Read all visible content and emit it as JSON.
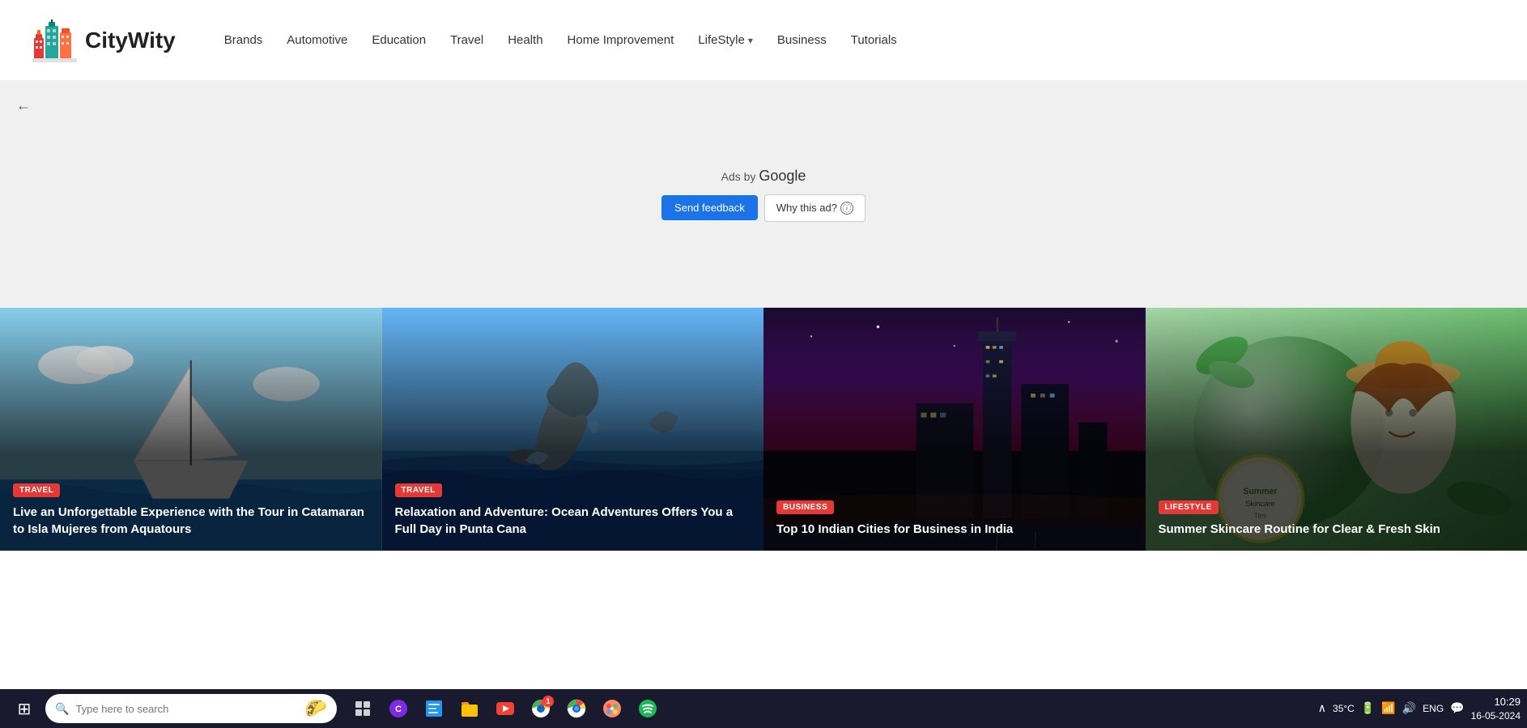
{
  "header": {
    "logo_text": "CityWity",
    "nav_items": [
      {
        "label": "Brands",
        "has_dropdown": false
      },
      {
        "label": "Automotive",
        "has_dropdown": false
      },
      {
        "label": "Education",
        "has_dropdown": false
      },
      {
        "label": "Travel",
        "has_dropdown": false
      },
      {
        "label": "Health",
        "has_dropdown": false
      },
      {
        "label": "Home Improvement",
        "has_dropdown": false
      },
      {
        "label": "LifeStyle",
        "has_dropdown": true
      },
      {
        "label": "Business",
        "has_dropdown": false
      },
      {
        "label": "Tutorials",
        "has_dropdown": false
      }
    ]
  },
  "ad_area": {
    "ads_label": "Ads by ",
    "google_label": "Google",
    "send_feedback_label": "Send feedback",
    "why_this_ad_label": "Why this ad?",
    "back_arrow": "←"
  },
  "cards": [
    {
      "badge": "TRAVEL",
      "badge_class": "badge-travel",
      "title": "Live an Unforgettable Experience with the Tour in Catamaran to Isla Mujeres from Aquatours",
      "bg_class": "card-bg-1"
    },
    {
      "badge": "TRAVEL",
      "badge_class": "badge-travel",
      "title": "Relaxation and Adventure: Ocean Adventures Offers You a Full Day in Punta Cana",
      "bg_class": "card-bg-2"
    },
    {
      "badge": "BUSINESS",
      "badge_class": "badge-business",
      "title": "Top 10 Indian Cities for Business in India",
      "bg_class": "card-bg-3"
    },
    {
      "badge": "LIFESTYLE",
      "badge_class": "badge-lifestyle",
      "title": "Summer Skincare Routine for Clear & Fresh Skin",
      "bg_class": "card-bg-4"
    }
  ],
  "taskbar": {
    "search_placeholder": "Type here to search",
    "time": "10:29",
    "date": "16-05-2024",
    "language": "ENG",
    "temperature": "35°C",
    "apps": [
      {
        "icon": "⊞",
        "name": "task-view"
      },
      {
        "icon": "🔲",
        "name": "canva"
      },
      {
        "icon": "📘",
        "name": "notes"
      },
      {
        "icon": "📁",
        "name": "file-explorer"
      },
      {
        "icon": "▶",
        "name": "youtube"
      },
      {
        "icon": "🔴",
        "name": "chrome-1"
      },
      {
        "icon": "🟢",
        "name": "chrome-2"
      },
      {
        "icon": "🎨",
        "name": "paint"
      },
      {
        "icon": "🎵",
        "name": "spotify"
      }
    ]
  }
}
